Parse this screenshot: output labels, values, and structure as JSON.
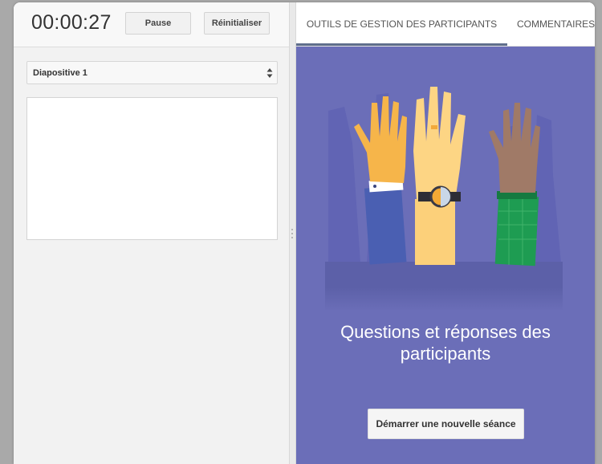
{
  "presenter": {
    "timer": "00:00:27",
    "pause_label": "Pause",
    "reset_label": "Réinitialiser",
    "slide_select_value": "Diapositive 1"
  },
  "audience_tools": {
    "tabs": [
      {
        "label": "OUTILS DE GESTION DES PARTICIPANTS",
        "active": true
      },
      {
        "label": "COMMENTAIRES",
        "active": false
      }
    ],
    "panel_title_line1": "Questions et réponses des",
    "panel_title_line2": "participants",
    "start_button_label": "Démarrer une nouvelle séance"
  },
  "colors": {
    "panel_background": "#6b6eb8",
    "active_tab_underline": "#5f6e8c"
  },
  "illustration": {
    "icons": [
      "raised-hand-blue-sleeve-icon",
      "raised-hand-watch-icon",
      "raised-hand-green-sleeve-icon"
    ]
  }
}
